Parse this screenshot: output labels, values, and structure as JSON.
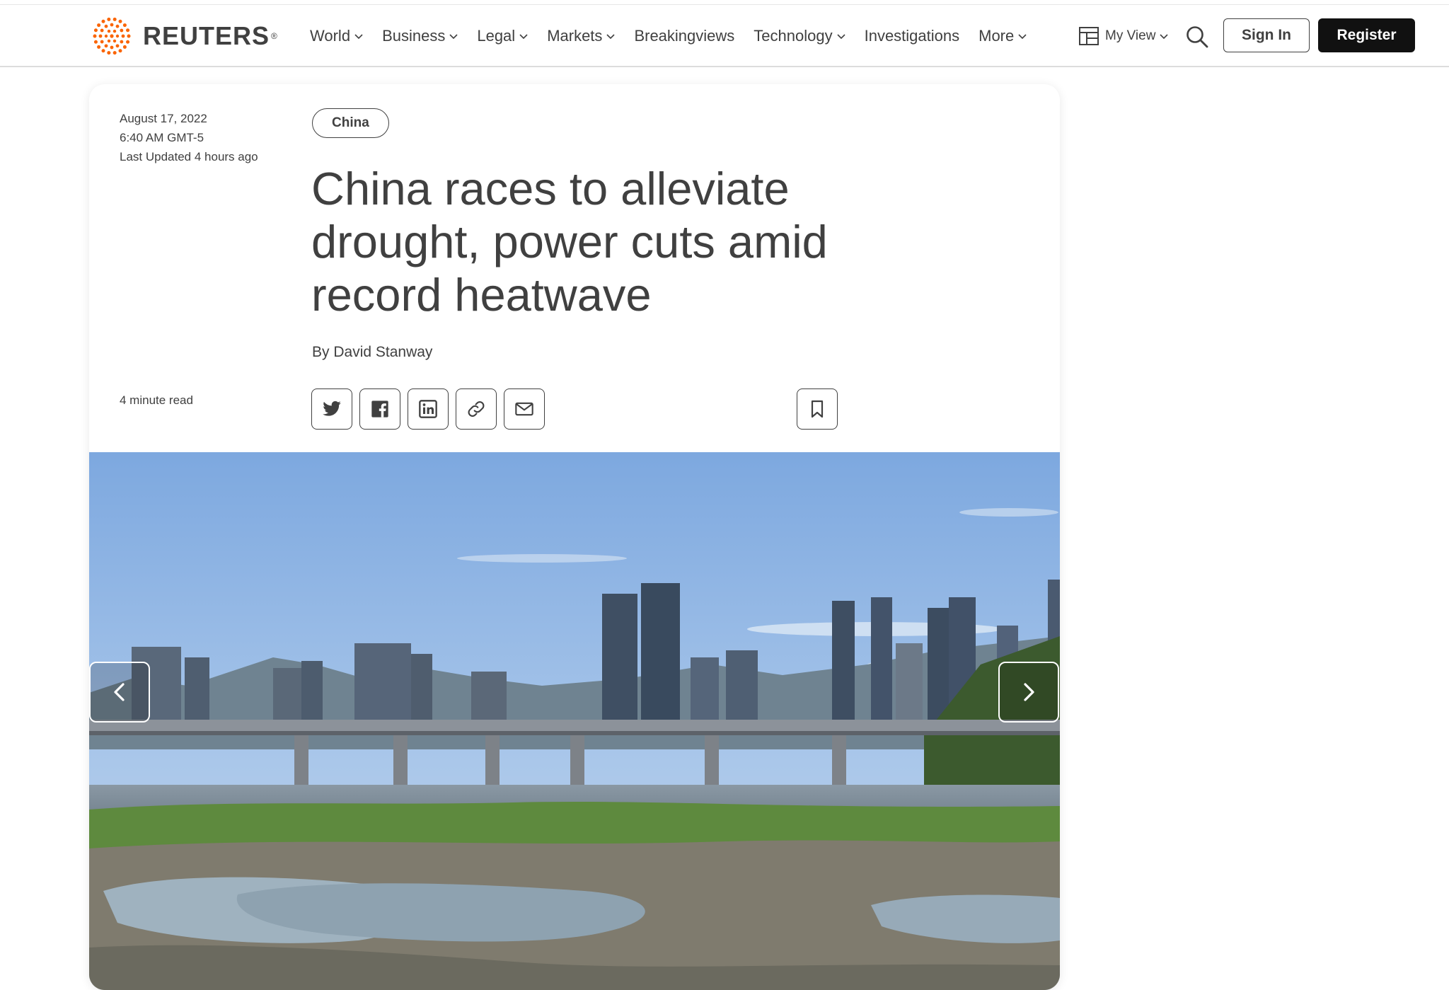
{
  "header": {
    "brand": "REUTERS",
    "brand_mark": "®",
    "nav": [
      {
        "label": "World",
        "has_menu": true
      },
      {
        "label": "Business",
        "has_menu": true
      },
      {
        "label": "Legal",
        "has_menu": true
      },
      {
        "label": "Markets",
        "has_menu": true
      },
      {
        "label": "Breakingviews",
        "has_menu": false
      },
      {
        "label": "Technology",
        "has_menu": true
      },
      {
        "label": "Investigations",
        "has_menu": false
      },
      {
        "label": "More",
        "has_menu": true
      }
    ],
    "my_view": "My View",
    "sign_in": "Sign In",
    "register": "Register"
  },
  "article": {
    "date": "August 17, 2022",
    "time": "6:40 AM GMT-5",
    "updated": "Last Updated 4 hours ago",
    "tag": "China",
    "headline": "China races to alleviate drought, power cuts amid record heatwave",
    "byline_prefix": "By ",
    "author": "David Stanway",
    "read_time": "4 minute read",
    "share_icons": [
      "twitter-icon",
      "facebook-icon",
      "linkedin-icon",
      "link-icon",
      "email-icon"
    ],
    "bookmark_icon": "bookmark-icon"
  },
  "photo": {
    "carousel_prev_icon": "chevron-left-icon",
    "carousel_next_icon": "chevron-right-icon"
  },
  "colors": {
    "brand_orange": "#fa6400",
    "text": "#404040",
    "register_bg": "#111111"
  }
}
